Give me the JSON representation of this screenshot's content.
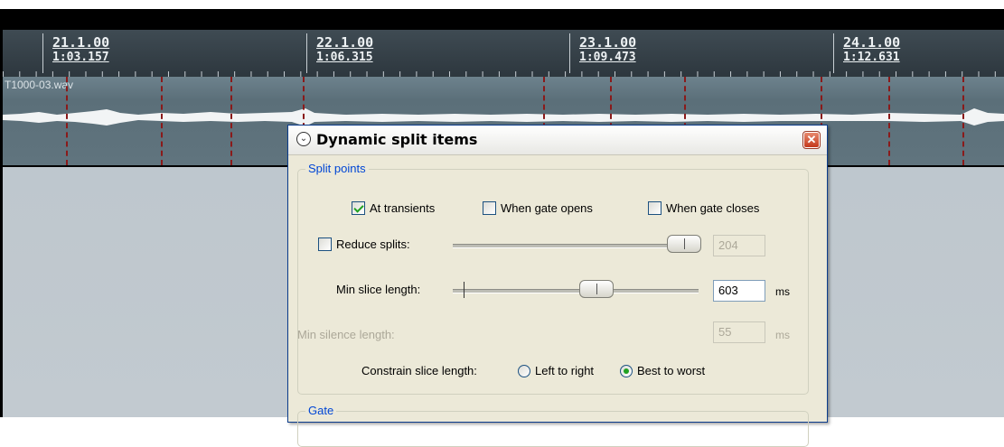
{
  "ruler": {
    "markers": [
      {
        "beat": "21.1.00",
        "time": "1:03.157"
      },
      {
        "beat": "22.1.00",
        "time": "1:06.315"
      },
      {
        "beat": "23.1.00",
        "time": "1:09.473"
      },
      {
        "beat": "24.1.00",
        "time": "1:12.631"
      }
    ]
  },
  "track": {
    "item_name": "T1000-03.wav"
  },
  "dialog": {
    "title": "Dynamic split items",
    "close_glyph": "✕",
    "split_points": {
      "label": "Split points",
      "at_transients": {
        "label": "At transients",
        "checked": true
      },
      "when_gate_opens": {
        "label": "When gate opens",
        "checked": false
      },
      "when_gate_closes": {
        "label": "When gate closes",
        "checked": false
      },
      "reduce_splits": {
        "label": "Reduce splits:",
        "checked": false,
        "value": "204",
        "slider_fraction": 0.88
      },
      "min_slice_length": {
        "label": "Min slice length:",
        "value": "603",
        "unit": "ms",
        "slider_fraction": 0.53
      },
      "min_silence_length": {
        "label": "Min silence length:",
        "value": "55",
        "unit": "ms"
      },
      "constrain": {
        "label": "Constrain slice length:",
        "options": [
          "Left to right",
          "Best to worst"
        ],
        "selected": "Best to worst"
      }
    },
    "gate": {
      "label": "Gate"
    }
  },
  "colors": {
    "ruler_bg": "#333e45",
    "track_bg": "#60747e",
    "split_line": "#8a1a1a",
    "dialog_bg": "#ece9d8",
    "group_label": "#0046d5",
    "check_green": "#21a121"
  }
}
